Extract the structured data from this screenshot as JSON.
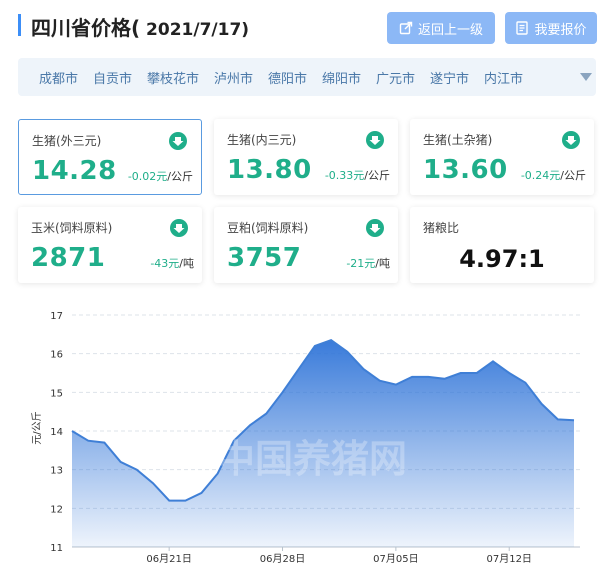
{
  "header": {
    "title": "四川省价格(",
    "date": " 2021/7/17)",
    "back_label": "返回上一级",
    "report_label": "我要报价"
  },
  "cities": [
    "成都市",
    "自贡市",
    "攀枝花市",
    "泸州市",
    "德阳市",
    "绵阳市",
    "广元市",
    "遂宁市",
    "内江市"
  ],
  "cards": [
    {
      "name": "生猪(外三元)",
      "value": "14.28",
      "change": "-0.02元",
      "unit": "/公斤"
    },
    {
      "name": "生猪(内三元)",
      "value": "13.80",
      "change": "-0.33元",
      "unit": "/公斤"
    },
    {
      "name": "生猪(土杂猪)",
      "value": "13.60",
      "change": "-0.24元",
      "unit": "/公斤"
    },
    {
      "name": "玉米(饲料原料)",
      "value": "2871",
      "change": "-43元",
      "unit": "/吨"
    },
    {
      "name": "豆粕(饲料原料)",
      "value": "3757",
      "change": "-21元",
      "unit": "/吨"
    },
    {
      "name": "猪粮比",
      "value": "4.97:1"
    }
  ],
  "colors": {
    "accent": "#3c8ef7",
    "down": "#1fae8a",
    "line": "#3f7fd6"
  },
  "chart_data": {
    "type": "area",
    "ylabel": "元/公斤",
    "watermark": "中国养猪网",
    "ylim": [
      11,
      17
    ],
    "yticks": [
      11,
      12,
      13,
      14,
      15,
      16,
      17
    ],
    "xticks": [
      {
        "label": "06月21日",
        "x": 6
      },
      {
        "label": "06月28日",
        "x": 13
      },
      {
        "label": "07月05日",
        "x": 20
      },
      {
        "label": "07月12日",
        "x": 27
      }
    ],
    "series": [
      {
        "x": [
          0,
          1,
          2,
          3,
          4,
          5,
          6,
          7,
          8,
          9,
          10,
          11,
          12,
          13,
          14,
          15,
          16,
          17,
          18,
          19,
          20,
          21,
          22,
          23,
          24,
          25,
          26,
          27,
          28,
          29,
          30,
          31
        ],
        "values": [
          14.0,
          13.75,
          13.7,
          13.2,
          13.0,
          12.65,
          12.2,
          12.2,
          12.4,
          12.9,
          13.75,
          14.15,
          14.45,
          15.0,
          15.6,
          16.2,
          16.35,
          16.05,
          15.6,
          15.3,
          15.2,
          15.4,
          15.4,
          15.35,
          15.5,
          15.5,
          15.8,
          15.5,
          15.25,
          14.7,
          14.3,
          14.28
        ]
      }
    ]
  }
}
